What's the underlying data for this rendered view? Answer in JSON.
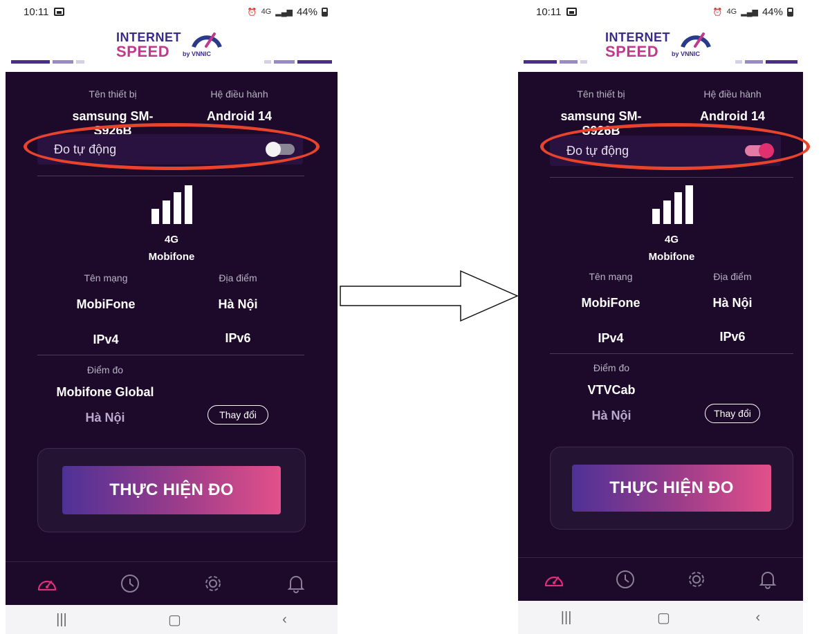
{
  "phones": [
    {
      "status": {
        "time": "10:11",
        "net": "4G",
        "battery": "44%"
      },
      "logo": {
        "line1": "INTERNET",
        "line2": "SPEED",
        "by": "by VNNIC"
      },
      "device": {
        "name_label": "Tên thiết bị",
        "name_value": "samsung SM-S926B",
        "os_label": "Hệ điều hành",
        "os_value": "Android 14"
      },
      "auto_measure": {
        "label": "Đo tự động",
        "enabled": false
      },
      "connection": {
        "type": "4G",
        "carrier": "Mobifone"
      },
      "network": {
        "name_label": "Tên mạng",
        "name_value": "MobiFone",
        "location_label": "Địa điểm",
        "location_value": "Hà Nội",
        "ipv4": "IPv4",
        "ipv6": "IPv6"
      },
      "server": {
        "label": "Điểm đo",
        "name": "Mobifone Global",
        "city": "Hà Nội",
        "change_label": "Thay đổi"
      },
      "cta_label": "THỰC HIỆN ĐO"
    },
    {
      "status": {
        "time": "10:11",
        "net": "4G",
        "battery": "44%"
      },
      "logo": {
        "line1": "INTERNET",
        "line2": "SPEED",
        "by": "by VNNIC"
      },
      "device": {
        "name_label": "Tên thiết bị",
        "name_value": "samsung SM-S926B",
        "os_label": "Hệ điều hành",
        "os_value": "Android 14"
      },
      "auto_measure": {
        "label": "Đo tự động",
        "enabled": true
      },
      "connection": {
        "type": "4G",
        "carrier": "Mobifone"
      },
      "network": {
        "name_label": "Tên mạng",
        "name_value": "MobiFone",
        "location_label": "Địa điểm",
        "location_value": "Hà Nội",
        "ipv4": "IPv4",
        "ipv6": "IPv6"
      },
      "server": {
        "label": "Điểm đo",
        "name": "VTVCab",
        "city": "Hà Nội",
        "change_label": "Thay đổi"
      },
      "cta_label": "THỰC HIỆN ĐO"
    }
  ],
  "colors": {
    "app_bg": "#1d0a2b",
    "accent_pink": "#e0306f",
    "brand_purple": "#3a2a8a",
    "annotation_red": "#e8432c"
  },
  "icons": [
    "speedometer-icon",
    "history-clock-icon",
    "settings-gear-icon",
    "notification-bell-icon",
    "arrow-right-icon"
  ]
}
